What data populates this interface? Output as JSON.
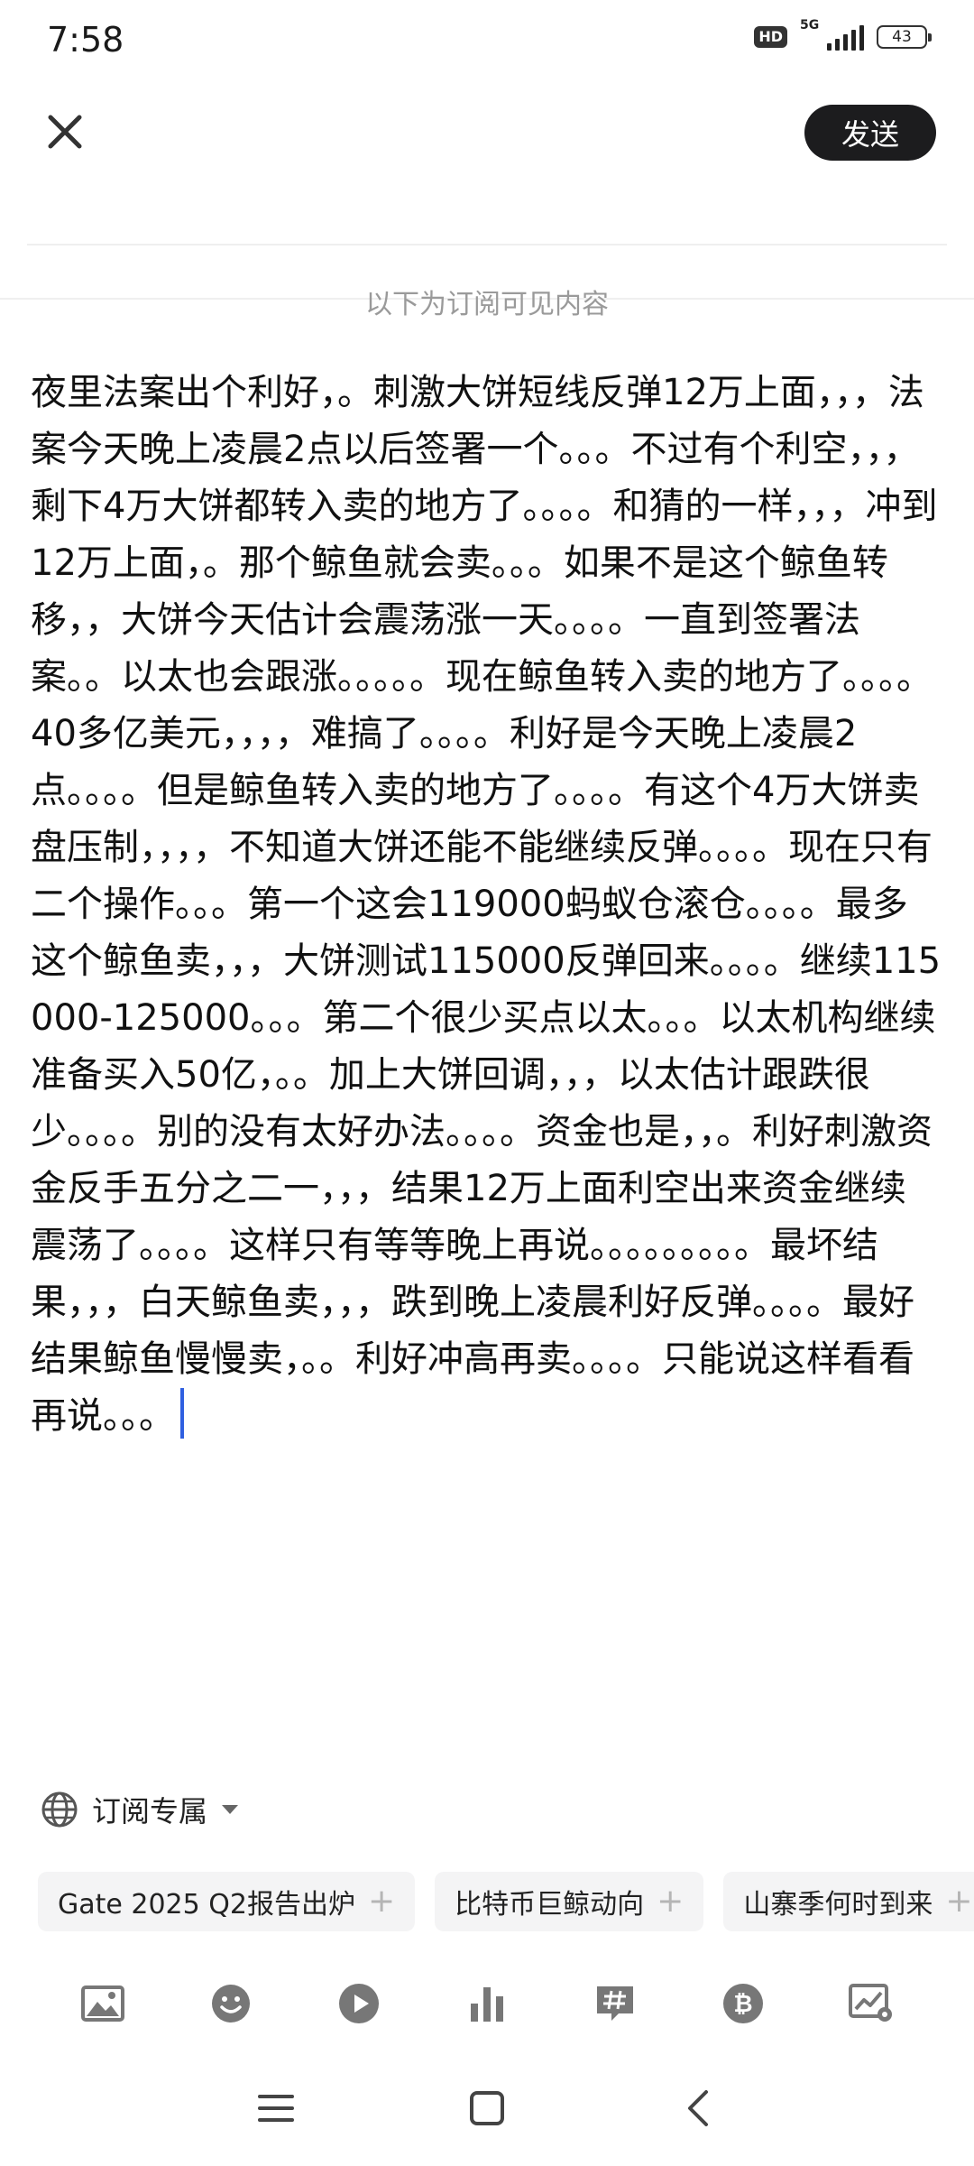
{
  "status_bar": {
    "time": "7:58",
    "hd": "HD",
    "network": "5G",
    "battery": "43"
  },
  "header": {
    "close_icon": "close-icon",
    "send_label": "发送"
  },
  "subscriber_hint": "以下为订阅可见内容",
  "post": {
    "body": "夜里法案出个利好，。刺激大饼短线反弹12万上面，，，法案今天晚上凌晨2点以后签署一个。。。不过有个利空，，，剩下4万大饼都转入卖的地方了。。。。和猜的一样，，，冲到12万上面，。那个鲸鱼就会卖。。。如果不是这个鲸鱼转移，，大饼今天估计会震荡涨一天。。。。一直到签署法案。。以太也会跟涨。。。。。现在鲸鱼转入卖的地方了。。。。40多亿美元，，，，难搞了。。。。利好是今天晚上凌晨2点。。。。但是鲸鱼转入卖的地方了。。。。有这个4万大饼卖盘压制，，，，不知道大饼还能不能继续反弹。。。。现在只有二个操作。。。第一个这会119000蚂蚁仓滚仓。。。。最多这个鲸鱼卖，，，大饼测试115000反弹回来。。。。继续115000-125000。。。第二个很少买点以太。。。以太机构继续准备买入50亿，。。加上大饼回调，，，以太估计跟跌很少。。。。别的没有太好办法。。。。资金也是，，。利好刺激资金反手五分之二一，，，结果12万上面利空出来资金继续震荡了。。。。这样只有等等晚上再说。。。。。。。。。最坏结果，，，白天鲸鱼卖，，，跌到晚上凌晨利好反弹。。。。最好结果鲸鱼慢慢卖，。。利好冲高再卖。。。。只能说这样看看再说。。。"
  },
  "visibility": {
    "icon": "globe-icon",
    "label": "订阅专属"
  },
  "topics": [
    {
      "label": "Gate 2025 Q2报告出炉"
    },
    {
      "label": "比特币巨鲸动向"
    },
    {
      "label": "山寨季何时到来"
    }
  ],
  "toolbar": [
    {
      "icon": "image-icon"
    },
    {
      "icon": "emoji-icon"
    },
    {
      "icon": "video-play-icon"
    },
    {
      "icon": "bar-chart-icon"
    },
    {
      "icon": "hashtag-icon"
    },
    {
      "icon": "bitcoin-icon"
    },
    {
      "icon": "trend-chart-icon"
    }
  ],
  "nav": [
    {
      "icon": "menu-icon"
    },
    {
      "icon": "home-icon"
    },
    {
      "icon": "back-icon"
    }
  ],
  "colors": {
    "accent_caret": "#2f5fe0",
    "send_bg": "#1c1c1e",
    "chip_bg": "#f4f4f5",
    "icon_gray": "#777777"
  }
}
